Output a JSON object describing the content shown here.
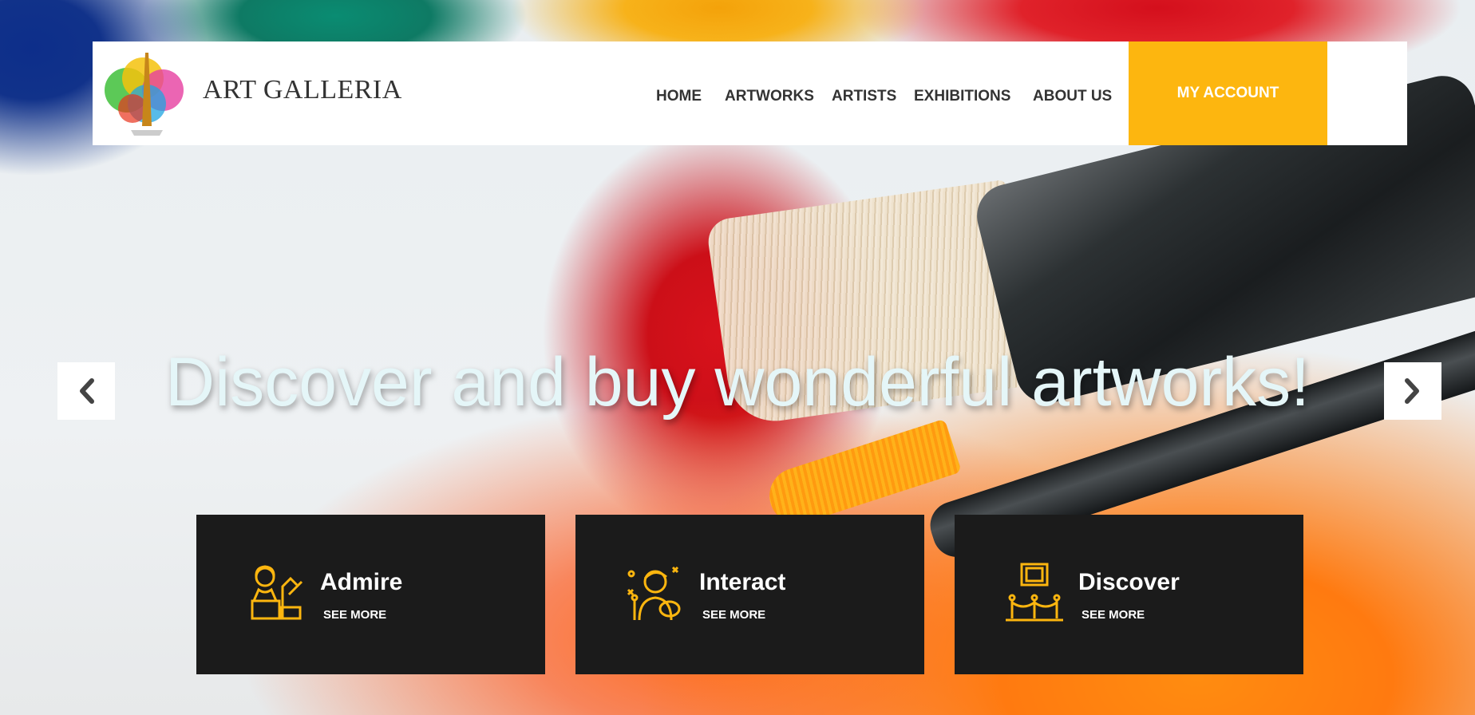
{
  "header": {
    "brand": "ART GALLERIA",
    "nav": [
      "HOME",
      "ARTWORKS",
      "ARTISTS",
      "EXHIBITIONS",
      "ABOUT US"
    ],
    "account_button": "MY ACCOUNT"
  },
  "hero": {
    "headline": "Discover and buy wonderful artworks!"
  },
  "cards": [
    {
      "title": "Admire",
      "link": "SEE MORE",
      "icon": "statue-icon"
    },
    {
      "title": "Interact",
      "link": "SEE MORE",
      "icon": "artist-icon"
    },
    {
      "title": "Discover",
      "link": "SEE MORE",
      "icon": "gallery-frame-icon"
    }
  ],
  "colors": {
    "accent": "#fdb60f",
    "card_bg": "#1b1b1b",
    "headline": "#e5f6f8"
  }
}
